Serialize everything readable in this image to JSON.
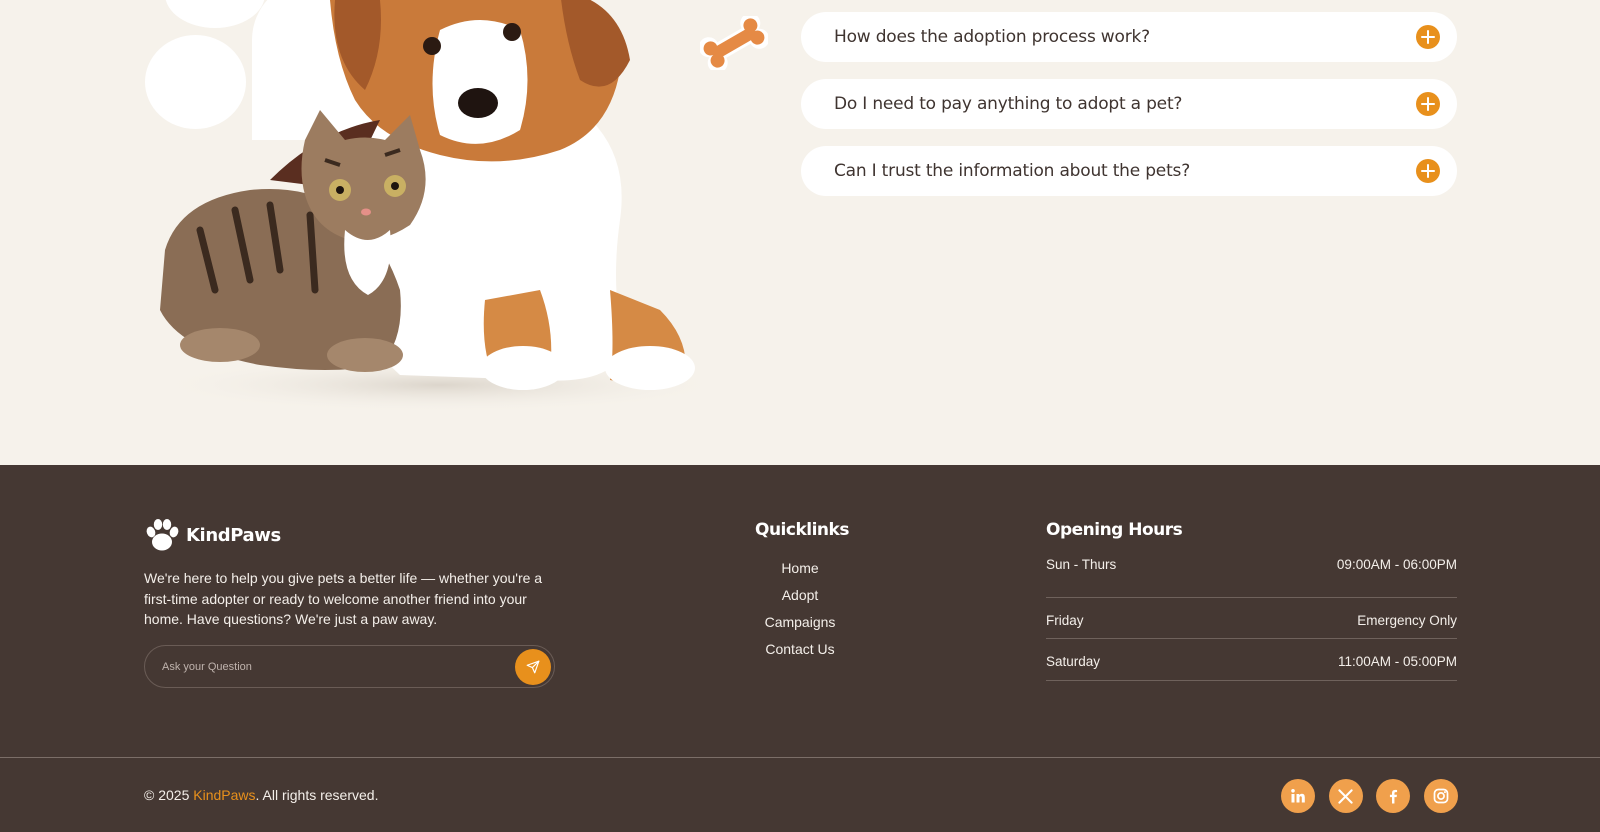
{
  "faq": {
    "items": [
      {
        "question": "How does the adoption process work?"
      },
      {
        "question": "Do I need to pay anything to adopt a pet?"
      },
      {
        "question": "Can I trust the information about the pets?"
      }
    ]
  },
  "footer": {
    "brand": {
      "name": "KindPaws",
      "icon": "paw-icon"
    },
    "tagline": "We're here to help you give pets a better life — whether you're a first-time adopter or ready to welcome another friend into your home. Have questions? We're just a paw away.",
    "ask": {
      "placeholder": "Ask your Question",
      "value": "",
      "icon": "send-icon"
    },
    "quicklinks": {
      "title": "Quicklinks",
      "items": [
        "Home",
        "Adopt",
        "Campaigns",
        "Contact Us"
      ]
    },
    "opening_hours": {
      "title": "Opening Hours",
      "rows": [
        {
          "day": "Sun - Thurs",
          "time": "09:00AM - 06:00PM"
        },
        {
          "day": "Friday",
          "time": "Emergency Only"
        },
        {
          "day": "Saturday",
          "time": "11:00AM - 05:00PM"
        }
      ]
    },
    "copyright": {
      "prefix": "© 2025 ",
      "brand": "KindPaws",
      "suffix": ". All rights reserved."
    },
    "socials": [
      "linkedin-icon",
      "x-icon",
      "facebook-icon",
      "instagram-icon"
    ]
  },
  "colors": {
    "accent": "#e8901c",
    "footer_bg": "#453833",
    "page_bg": "#f6f2eb",
    "social_bg": "#f0a04c"
  }
}
